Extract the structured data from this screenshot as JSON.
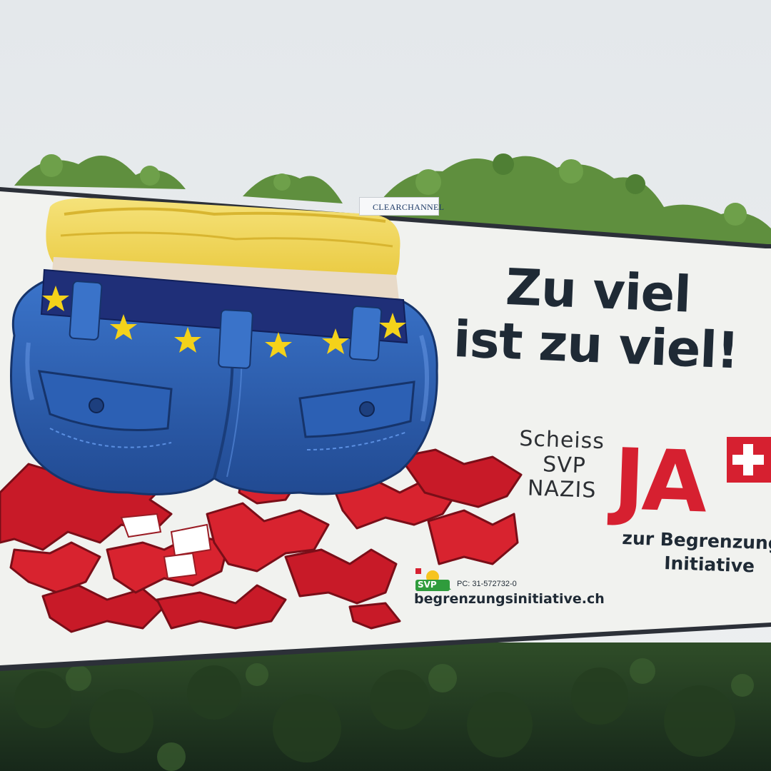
{
  "billboard": {
    "headline_line1": "Zu viel",
    "headline_line2": "ist zu viel!",
    "vote_word": "JA",
    "subline_1": "zur Begrenzung",
    "subline_2": "Initiative",
    "website": "begrenzungsinitiative.ch",
    "postal_account": "PC: 31-572732-0",
    "party_logo_text": "SVP",
    "graffiti": [
      "Scheiss",
      "SVP",
      "NAZIS"
    ]
  },
  "operator_tag": "CLEARCHANNEL",
  "colors": {
    "sky": "#e9ecee",
    "poster_bg": "#f1f2ef",
    "swiss_red": "#d62030",
    "denim": "#2f63b8",
    "eu_blue": "#1f2f78",
    "eu_star": "#f4d21a",
    "headline_text": "#1f2a35",
    "foliage": "#2d4a24"
  }
}
